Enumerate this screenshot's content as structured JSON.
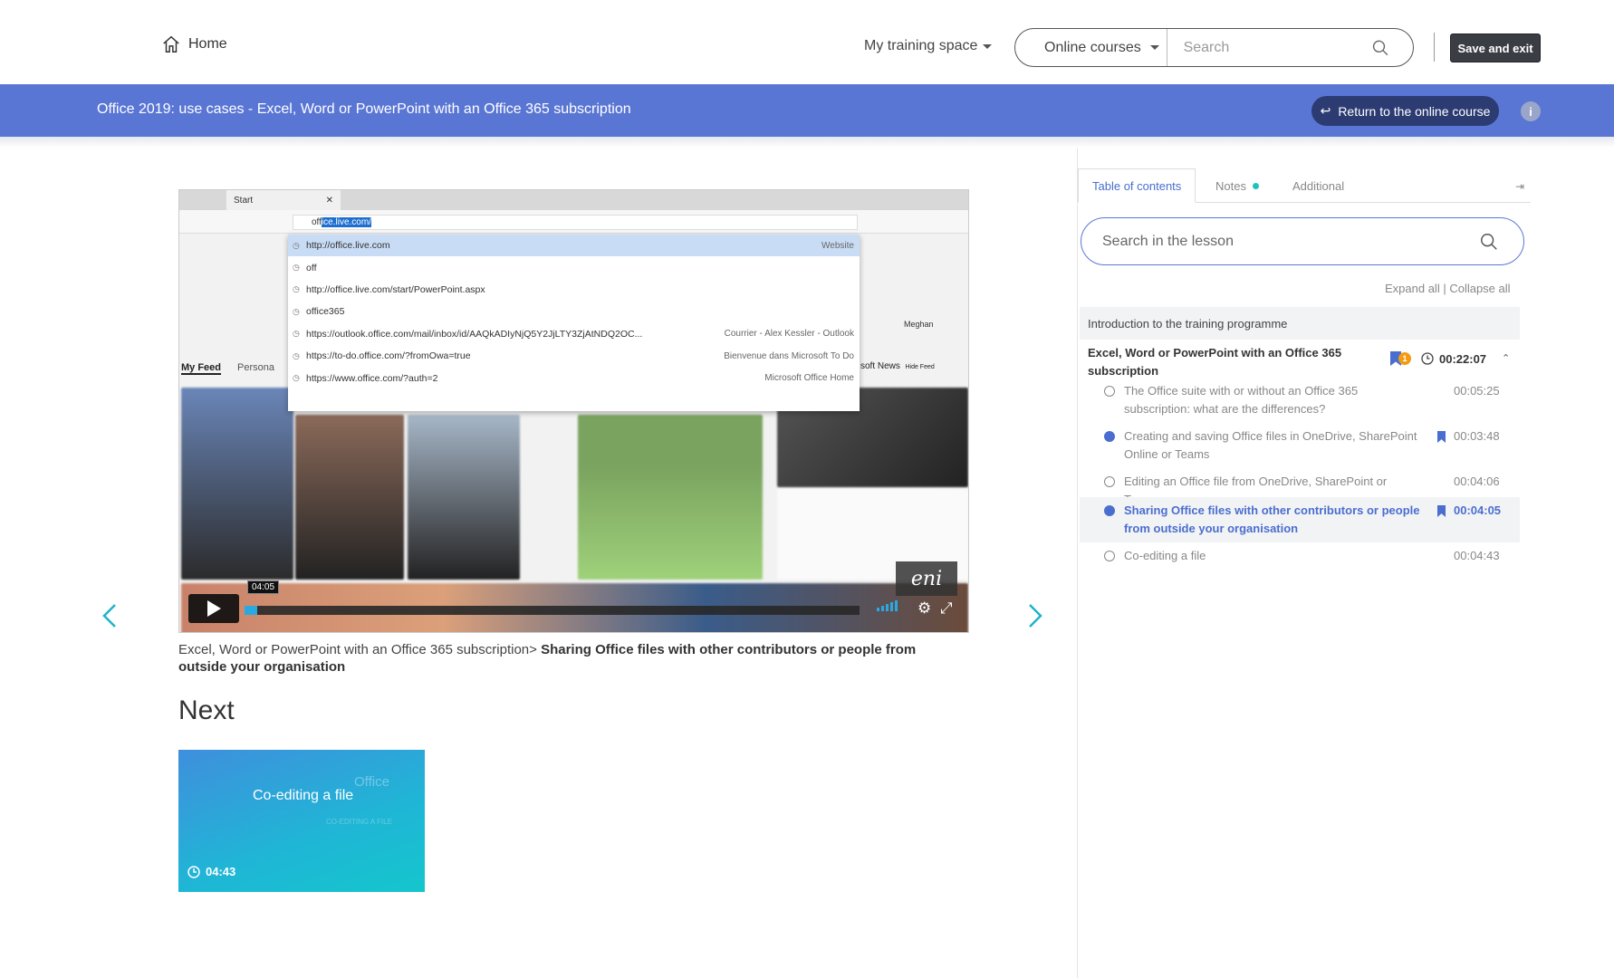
{
  "header": {
    "home_label": "Home",
    "training_space_label": "My training space",
    "search_scope": "Online courses",
    "search_placeholder": "Search",
    "save_exit_label": "Save and exit"
  },
  "banner": {
    "course_title": "Office 2019: use cases - Excel, Word or PowerPoint with an Office 365 subscription",
    "return_label": "Return to the online course",
    "info_label": "i"
  },
  "video": {
    "browser_tab": "Start",
    "address_text_plain": "off",
    "address_text_selected": "ice.live.com/",
    "dropdown": [
      {
        "text": "http://office.live.com",
        "right": "Website"
      },
      {
        "text": "off",
        "right": ""
      },
      {
        "text": "http://office.live.com/start/PowerPoint.aspx",
        "right": ""
      },
      {
        "text": "office365",
        "right": ""
      },
      {
        "text": "https://outlook.office.com/mail/inbox/id/AAQkADIyNjQ5Y2JjLTY3ZjAtNDQ2OC...",
        "right": "Courrier - Alex Kessler - Outlook"
      },
      {
        "text": "https://to-do.office.com/?fromOwa=true",
        "right": "Bienvenue dans Microsoft To Do"
      },
      {
        "text": "https://www.office.com/?auth=2",
        "right": "Microsoft Office Home"
      }
    ],
    "feed_tab": "My Feed",
    "personal_tab": "Persona",
    "news_label": "soft News",
    "hide_feed": "Hide Feed",
    "user_name": "Meghan",
    "current_time": "04:05",
    "logo": "eni",
    "progress_fraction": 0.02
  },
  "breadcrumb": {
    "parent": "Excel, Word or PowerPoint with an Office 365 subscription>",
    "current": "Sharing Office files with other contributors or people from outside your organisation"
  },
  "next": {
    "heading": "Next",
    "card_title": "Co-editing a file",
    "card_watermark": "Office",
    "card_subtitle": "CO-EDITING A FILE",
    "card_duration": "04:43"
  },
  "sidebar": {
    "tabs": {
      "toc": "Table of contents",
      "notes": "Notes",
      "additional": "Additional"
    },
    "search_placeholder": "Search in the lesson",
    "expand_all": "Expand all",
    "separator": " | ",
    "collapse_all": "Collapse all",
    "intro": "Introduction to the training programme",
    "chapter": {
      "title": "Excel, Word or PowerPoint with an Office 365 subscription",
      "badge": "1",
      "duration": "00:22:07"
    },
    "lessons": [
      {
        "title": "The Office suite with or without an Office 365 subscription: what are the differences?",
        "duration": "00:05:25"
      },
      {
        "title": "Creating and saving Office files in OneDrive, SharePoint Online or Teams",
        "duration": "00:03:48"
      },
      {
        "title": "Editing an Office file from OneDrive, SharePoint or Teams",
        "duration": "00:04:06"
      },
      {
        "title": "Sharing Office files with other contributors or people from outside your organisation",
        "duration": "00:04:05"
      },
      {
        "title": "Co-editing a file",
        "duration": "00:04:43"
      }
    ]
  },
  "colors": {
    "banner": "#5a76d4",
    "accent": "#4a6ecf",
    "return_button": "#2c3c73",
    "notes_dot": "#1fc2b9",
    "badge": "#f39c12"
  }
}
